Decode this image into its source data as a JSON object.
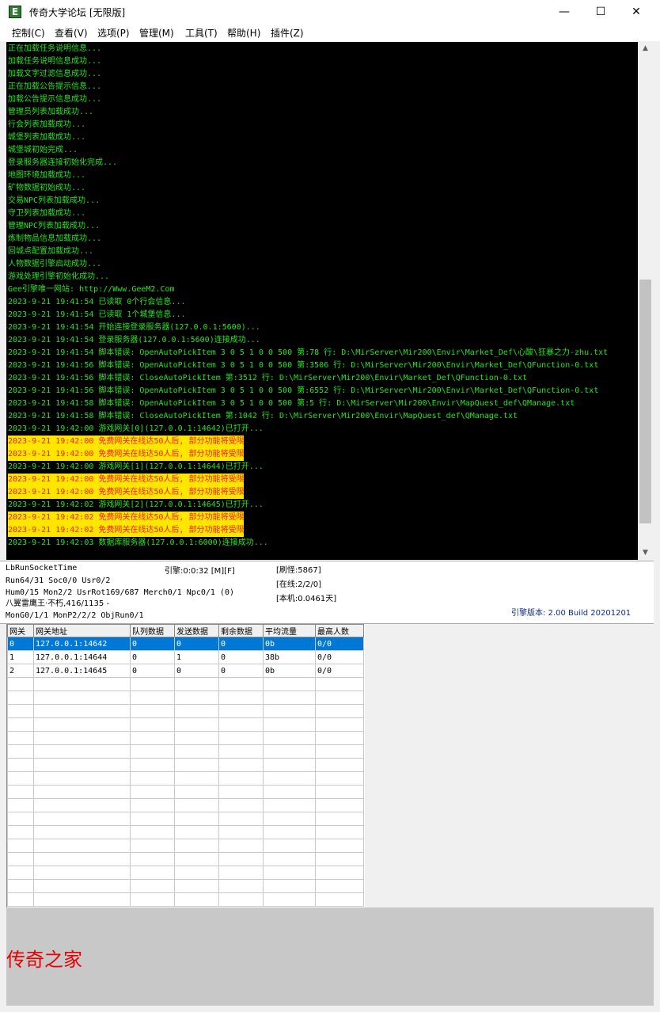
{
  "window": {
    "title": "传奇大学论坛 [无限版]",
    "app_icon_glyph": "E",
    "minimize_glyph": "—",
    "maximize_glyph": "☐",
    "close_glyph": "✕"
  },
  "menu": [
    "控制(C)",
    "查看(V)",
    "选项(P)",
    "管理(M)",
    "工具(T)",
    "帮助(H)",
    "插件(Z)"
  ],
  "console": {
    "lines": [
      {
        "text": "正在加载任务说明信息...",
        "warn": false
      },
      {
        "text": "加载任务说明信息成功...",
        "warn": false
      },
      {
        "text": "加载文字过滤信息成功...",
        "warn": false
      },
      {
        "text": "正在加载公告提示信息...",
        "warn": false
      },
      {
        "text": "加载公告提示信息成功...",
        "warn": false
      },
      {
        "text": "管理员列表加载成功...",
        "warn": false
      },
      {
        "text": "行会列表加载成功...",
        "warn": false
      },
      {
        "text": "城堡列表加载成功...",
        "warn": false
      },
      {
        "text": "城堡城初始完成...",
        "warn": false
      },
      {
        "text": "登录服务器连接初始化完成...",
        "warn": false
      },
      {
        "text": "地图环境加载成功...",
        "warn": false
      },
      {
        "text": "矿物数据初始成功...",
        "warn": false
      },
      {
        "text": "交易NPC列表加载成功...",
        "warn": false
      },
      {
        "text": "守卫列表加载成功...",
        "warn": false
      },
      {
        "text": "管理NPC列表加载成功...",
        "warn": false
      },
      {
        "text": "炼制物品信息加载成功...",
        "warn": false
      },
      {
        "text": "回城点配置加载成功...",
        "warn": false
      },
      {
        "text": "人物数据引擎启动成功...",
        "warn": false
      },
      {
        "text": "游戏处理引擎初始化成功...",
        "warn": false
      },
      {
        "text": "Gee引擎唯一网站: http://Www.GeeM2.Com",
        "warn": false
      },
      {
        "text": "2023-9-21 19:41:54 已读取 0个行会信息...",
        "warn": false
      },
      {
        "text": "2023-9-21 19:41:54 已读取 1个城堡信息...",
        "warn": false
      },
      {
        "text": "2023-9-21 19:41:54 开始连接登录服务器(127.0.0.1:5600)...",
        "warn": false
      },
      {
        "text": "2023-9-21 19:41:54 登录服务器(127.0.0.1:5600)连接成功...",
        "warn": false
      },
      {
        "text": "2023-9-21 19:41:54 脚本错误: OpenAutoPickItem 3 0 5 1 0 0 500 第:78 行: D:\\MirServer\\Mir200\\Envir\\Market_Def\\心酸\\狂暴之力-zhu.txt",
        "warn": false
      },
      {
        "text": "2023-9-21 19:41:56 脚本错误: OpenAutoPickItem 3 0 5 1 0 0 500 第:3506 行: D:\\MirServer\\Mir200\\Envir\\Market_Def\\QFunction-0.txt",
        "warn": false
      },
      {
        "text": "2023-9-21 19:41:56 脚本错误: CloseAutoPickItem 第:3512 行: D:\\MirServer\\Mir200\\Envir\\Market_Def\\QFunction-0.txt",
        "warn": false
      },
      {
        "text": "2023-9-21 19:41:56 脚本错误: OpenAutoPickItem 3 0 5 1 0 0 500 第:6552 行: D:\\MirServer\\Mir200\\Envir\\Market_Def\\QFunction-0.txt",
        "warn": false
      },
      {
        "text": "2023-9-21 19:41:58 脚本错误: OpenAutoPickItem 3 0 5 1 0 0 500 第:5 行: D:\\MirServer\\Mir200\\Envir\\MapQuest_def\\QManage.txt",
        "warn": false
      },
      {
        "text": "2023-9-21 19:41:58 脚本错误: CloseAutoPickItem 第:1042 行: D:\\MirServer\\Mir200\\Envir\\MapQuest_def\\QManage.txt",
        "warn": false
      },
      {
        "text": "2023-9-21 19:42:00 游戏网关[0](127.0.0.1:14642)已打开...",
        "warn": false
      },
      {
        "text": "2023-9-21 19:42:00 免费网关在线达50人后, 部分功能将受限",
        "warn": true
      },
      {
        "text": "2023-9-21 19:42:00 免费网关在线达50人后, 部分功能将受限",
        "warn": true
      },
      {
        "text": "2023-9-21 19:42:00 游戏网关[1](127.0.0.1:14644)已打开...",
        "warn": false
      },
      {
        "text": "2023-9-21 19:42:00 免费网关在线达50人后, 部分功能将受限",
        "warn": true
      },
      {
        "text": "2023-9-21 19:42:00 免费网关在线达50人后, 部分功能将受限",
        "warn": true
      },
      {
        "text": "2023-9-21 19:42:02 游戏网关[2](127.0.0.1:14645)已打开...",
        "warn": false
      },
      {
        "text": "2023-9-21 19:42:02 免费网关在线达50人后, 部分功能将受限",
        "warn": true
      },
      {
        "text": "2023-9-21 19:42:02 免费网关在线达50人后, 部分功能将受限",
        "warn": true
      },
      {
        "text": "2023-9-21 19:42:03 数据库服务器(127.0.0.1:6000)连接成功...",
        "warn": false
      }
    ]
  },
  "status": {
    "line1": "LbRunSocketTime",
    "line2": "Run64/31 Soc0/0 Usr0/2",
    "line3": "Hum0/15 Mon2/2 UsrRot169/687 Merch0/1 Npc0/1 (0)",
    "line4": "八翼雷鹰王·不朽,416/1135 -",
    "line5": "MonG0/1/1 MonP2/2/2 ObjRun0/1",
    "engine_time": "引擎:0:0:32 [M][F]",
    "refresh": "[刷怪:5867]",
    "online": "[在线:2/2/0]",
    "local": "[本机:0.0461天]",
    "engine_version": "引擎版本: 2.00 Build 20201201"
  },
  "gateways": {
    "columns": [
      "网关",
      "网关地址",
      "队列数据",
      "发送数据",
      "剩余数据",
      "平均流量",
      "最高人数"
    ],
    "rows": [
      [
        "0",
        "127.0.0.1:14642",
        "0",
        "0",
        "0",
        "0b",
        "0/0"
      ],
      [
        "1",
        "127.0.0.1:14644",
        "0",
        "1",
        "0",
        "38b",
        "0/0"
      ],
      [
        "2",
        "127.0.0.1:14645",
        "0",
        "0",
        "0",
        "0b",
        "0/0"
      ]
    ],
    "selected_row": 0
  },
  "watermark": "传奇之家"
}
